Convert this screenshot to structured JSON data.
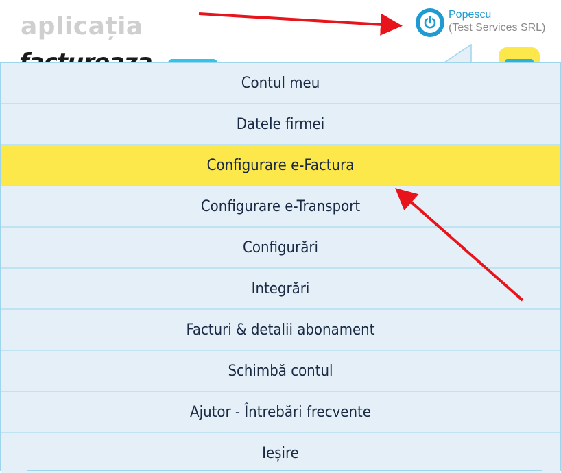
{
  "header": {
    "app_logo": "aplicația",
    "brand_logo": "factureaza",
    "user": {
      "name": "Popescu",
      "company": "(Test Services SRL)"
    }
  },
  "menu": {
    "items": [
      {
        "label": "Contul meu"
      },
      {
        "label": "Datele firmei"
      },
      {
        "label": "Configurare e-Factura",
        "active": true
      },
      {
        "label": "Configurare e-Transport"
      },
      {
        "label": "Configurări"
      },
      {
        "label": "Integrări"
      },
      {
        "label": "Facturi & detalii abonament"
      },
      {
        "label": "Schimbă contul"
      },
      {
        "label": "Ajutor - Întrebări frecvente"
      },
      {
        "label": "Ieșire"
      }
    ]
  },
  "colors": {
    "accent": "#1e9bd1",
    "highlight": "#fde84c",
    "menu_bg": "#e4eff7",
    "annotation": "#e8141b"
  },
  "icons": {
    "user": "power-icon",
    "burger": "menu-icon"
  }
}
